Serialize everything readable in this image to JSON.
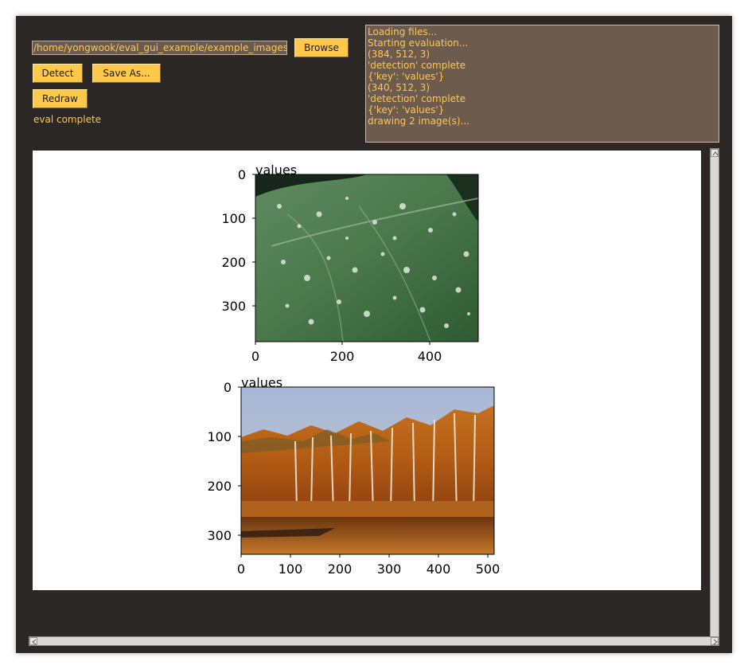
{
  "path_input": {
    "value": "/home/yongwook/eval_gui_example/example_images/"
  },
  "buttons": {
    "browse": "Browse",
    "detect": "Detect",
    "save_as": "Save As...",
    "redraw": "Redraw"
  },
  "status": "eval complete",
  "log_lines": [
    "Loading files...",
    "Starting evaluation...",
    "(384, 512, 3)",
    "'detection' complete",
    "{'key': 'values'}",
    "(340, 512, 3)",
    "'detection' complete",
    "{'key': 'values'}",
    "drawing 2 image(s)..."
  ],
  "plots": [
    {
      "title": "values",
      "image": "leaf-with-water-droplets",
      "ytick_labels": [
        "0",
        "100",
        "200",
        "300"
      ],
      "xtick_labels": [
        "0",
        "200",
        "400"
      ]
    },
    {
      "title": "values",
      "image": "autumn-birch-forest-by-lake",
      "ytick_labels": [
        "0",
        "100",
        "200",
        "300"
      ],
      "xtick_labels": [
        "0",
        "100",
        "200",
        "300",
        "400",
        "500"
      ]
    }
  ],
  "colors": {
    "window_bg": "#2b2724",
    "accent": "#ffc84a",
    "log_bg": "#6d5b4e"
  }
}
